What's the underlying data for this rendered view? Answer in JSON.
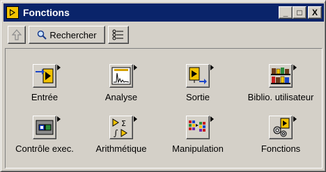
{
  "window": {
    "title": "Fonctions",
    "controls": {
      "minimize": "_",
      "maximize": "□",
      "close": "X"
    }
  },
  "toolbar": {
    "up_icon": "up-arrow-icon",
    "search_label": "Rechercher",
    "search_icon": "magnifier-icon",
    "options_icon": "palette-options-icon"
  },
  "palette": {
    "items": [
      {
        "label": "Entrée",
        "icon": "input-icon"
      },
      {
        "label": "Analyse",
        "icon": "analysis-icon"
      },
      {
        "label": "Sortie",
        "icon": "output-icon"
      },
      {
        "label": "Biblio. utilisateur",
        "icon": "user-library-icon"
      },
      {
        "label": "Contrôle exec.",
        "icon": "exec-control-icon"
      },
      {
        "label": "Arithmétique",
        "icon": "arithmetic-icon"
      },
      {
        "label": "Manipulation",
        "icon": "manipulation-icon"
      },
      {
        "label": "Fonctions",
        "icon": "functions-icon"
      }
    ]
  }
}
